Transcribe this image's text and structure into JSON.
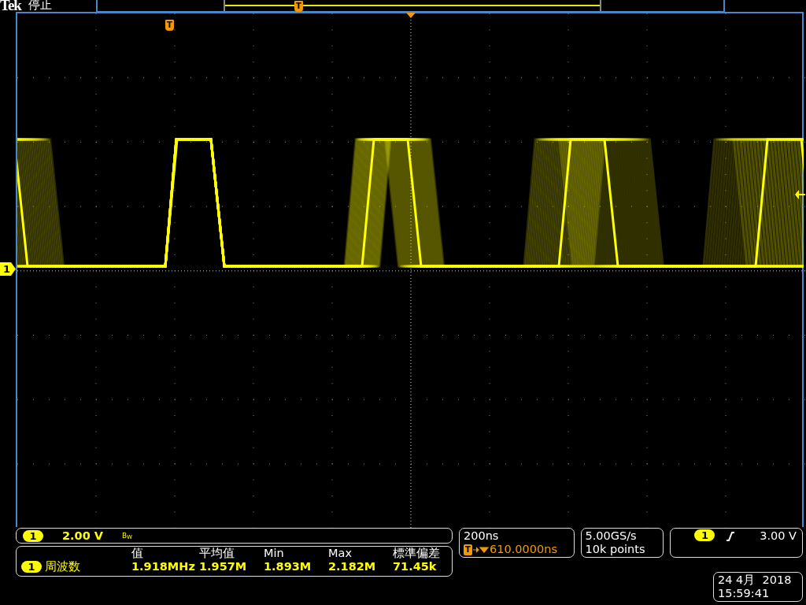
{
  "header": {
    "brand": "Tek",
    "state": "停止",
    "record_marker": "T"
  },
  "graticule": {
    "trigger_marker": "T",
    "channel_marker": "1"
  },
  "vertical": {
    "channel": "1",
    "scale": "2.00 V",
    "bandwidth": "B$_{W}$"
  },
  "measurements": {
    "columns": [
      "值",
      "平均值",
      "Min",
      "Max",
      "標準偏差"
    ],
    "rows": [
      {
        "channel": "1",
        "name": "周波数",
        "values": [
          "1.918MHz",
          "1.957M",
          "1.893M",
          "2.182M",
          "71.45k"
        ]
      }
    ]
  },
  "horizontal": {
    "scale": "200ns",
    "trigger_icon": "T",
    "position": "610.0000ns"
  },
  "acquisition": {
    "sample_rate": "5.00GS/s",
    "record_length": "10k points"
  },
  "trigger": {
    "source": "1",
    "rising_slope": true,
    "level": "3.00 V"
  },
  "datetime": {
    "date": "24 4月  2018",
    "time": "15:59:41"
  }
}
